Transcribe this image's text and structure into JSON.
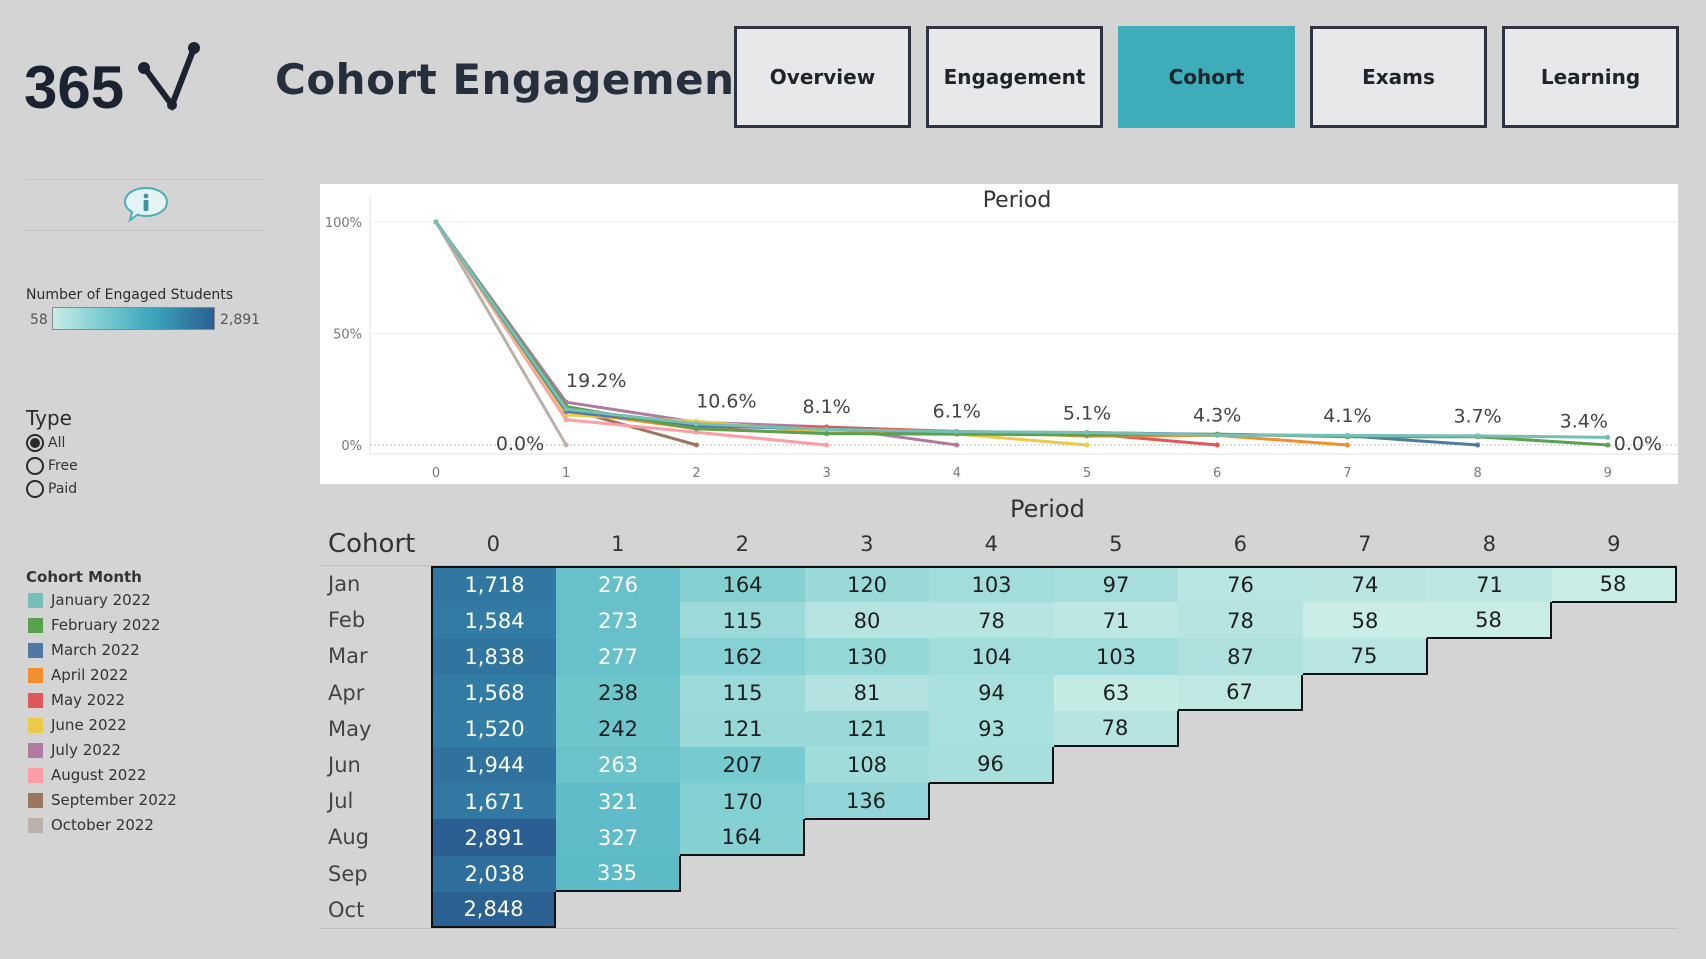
{
  "header": {
    "logo_text": "365",
    "title": "Cohort Engagement",
    "nav": [
      {
        "label": "Overview",
        "active": false
      },
      {
        "label": "Engagement",
        "active": false
      },
      {
        "label": "Cohort",
        "active": true
      },
      {
        "label": "Exams",
        "active": false
      },
      {
        "label": "Learning",
        "active": false
      }
    ]
  },
  "sidebar": {
    "info_icon": "info-speech-bubble-icon",
    "color_legend": {
      "title": "Number of Engaged Students",
      "min": "58",
      "max": "2,891"
    },
    "type_filter": {
      "title": "Type",
      "options": [
        {
          "label": "All",
          "selected": true
        },
        {
          "label": "Free",
          "selected": false
        },
        {
          "label": "Paid",
          "selected": false
        }
      ]
    },
    "cohort_legend": {
      "title": "Cohort Month",
      "items": [
        {
          "label": "January 2022",
          "color": "#76bfb6"
        },
        {
          "label": "February 2022",
          "color": "#59a14f"
        },
        {
          "label": "March 2022",
          "color": "#4e79a7"
        },
        {
          "label": "April 2022",
          "color": "#f28e2b"
        },
        {
          "label": "May 2022",
          "color": "#e15759"
        },
        {
          "label": "June 2022",
          "color": "#edc948"
        },
        {
          "label": "July 2022",
          "color": "#b07aa1"
        },
        {
          "label": "August 2022",
          "color": "#ff9da7"
        },
        {
          "label": "September 2022",
          "color": "#9c755f"
        },
        {
          "label": "October 2022",
          "color": "#bab0ac"
        }
      ]
    }
  },
  "chart_data": {
    "type": "line",
    "title": "Period",
    "xlabel": "",
    "ylabel": "",
    "x": [
      0,
      1,
      2,
      3,
      4,
      5,
      6,
      7,
      8,
      9
    ],
    "y_ticks": [
      "100%",
      "50%",
      "0%"
    ],
    "ylim": [
      0,
      100
    ],
    "grid": true,
    "series": [
      {
        "name": "January 2022",
        "color": "#76bfb6",
        "values": [
          100,
          16.1,
          9.5,
          7.0,
          6.0,
          5.6,
          4.4,
          4.3,
          4.1,
          3.4
        ]
      },
      {
        "name": "February 2022",
        "color": "#59a14f",
        "values": [
          100,
          17.2,
          7.3,
          5.1,
          4.9,
          4.5,
          4.9,
          3.7,
          3.7,
          0.0
        ]
      },
      {
        "name": "March 2022",
        "color": "#4e79a7",
        "values": [
          100,
          15.1,
          8.8,
          7.1,
          5.7,
          5.6,
          4.7,
          4.1,
          0.0
        ]
      },
      {
        "name": "April 2022",
        "color": "#f28e2b",
        "values": [
          100,
          15.2,
          7.3,
          5.2,
          6.0,
          4.0,
          4.3,
          0.0
        ]
      },
      {
        "name": "May 2022",
        "color": "#e15759",
        "values": [
          100,
          15.9,
          8.0,
          8.0,
          6.1,
          5.1,
          0.0
        ]
      },
      {
        "name": "June 2022",
        "color": "#edc948",
        "values": [
          100,
          13.5,
          10.6,
          5.6,
          4.9,
          0.0
        ]
      },
      {
        "name": "July 2022",
        "color": "#b07aa1",
        "values": [
          100,
          19.2,
          10.2,
          8.1,
          0.0
        ]
      },
      {
        "name": "August 2022",
        "color": "#ff9da7",
        "values": [
          100,
          11.3,
          5.7,
          0.0
        ]
      },
      {
        "name": "September 2022",
        "color": "#9c755f",
        "values": [
          100,
          16.4,
          0.0
        ]
      },
      {
        "name": "October 2022",
        "color": "#bab0ac",
        "values": [
          100,
          0.0
        ]
      }
    ],
    "annotations": [
      {
        "x": 1,
        "text": "0.0%"
      },
      {
        "x": 1,
        "text": "19.2%"
      },
      {
        "x": 2,
        "text": "10.6%"
      },
      {
        "x": 3,
        "text": "8.1%"
      },
      {
        "x": 4,
        "text": "6.1%"
      },
      {
        "x": 5,
        "text": "5.1%"
      },
      {
        "x": 6,
        "text": "4.3%"
      },
      {
        "x": 7,
        "text": "4.1%"
      },
      {
        "x": 8,
        "text": "3.7%"
      },
      {
        "x": 9,
        "text": "3.4%"
      },
      {
        "x": 9,
        "text": "0.0%"
      }
    ]
  },
  "cohort_table": {
    "period_title": "Period",
    "row_header": "Cohort",
    "periods": [
      "0",
      "1",
      "2",
      "3",
      "4",
      "5",
      "6",
      "7",
      "8",
      "9"
    ],
    "rows": [
      {
        "label": "Jan",
        "values": [
          "1,718",
          "276",
          "164",
          "120",
          "103",
          "97",
          "76",
          "74",
          "71",
          "58"
        ]
      },
      {
        "label": "Feb",
        "values": [
          "1,584",
          "273",
          "115",
          "80",
          "78",
          "71",
          "78",
          "58",
          "58"
        ]
      },
      {
        "label": "Mar",
        "values": [
          "1,838",
          "277",
          "162",
          "130",
          "104",
          "103",
          "87",
          "75"
        ]
      },
      {
        "label": "Apr",
        "values": [
          "1,568",
          "238",
          "115",
          "81",
          "94",
          "63",
          "67"
        ]
      },
      {
        "label": "May",
        "values": [
          "1,520",
          "242",
          "121",
          "121",
          "93",
          "78"
        ]
      },
      {
        "label": "Jun",
        "values": [
          "1,944",
          "263",
          "207",
          "108",
          "96"
        ]
      },
      {
        "label": "Jul",
        "values": [
          "1,671",
          "321",
          "170",
          "136"
        ]
      },
      {
        "label": "Aug",
        "values": [
          "2,891",
          "327",
          "164"
        ]
      },
      {
        "label": "Sep",
        "values": [
          "2,038",
          "335"
        ]
      },
      {
        "label": "Oct",
        "values": [
          "2,848"
        ]
      }
    ]
  }
}
